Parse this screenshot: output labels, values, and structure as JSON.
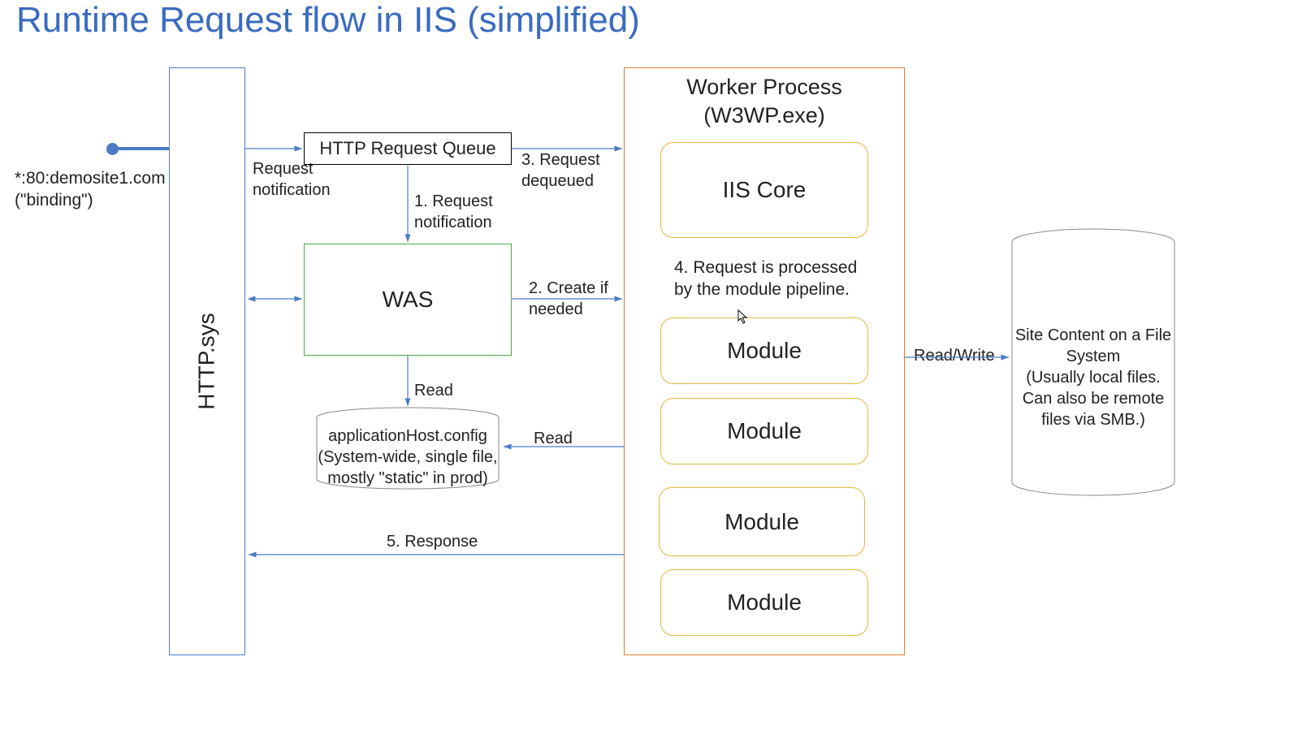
{
  "title": "Runtime Request flow in IIS (simplified)",
  "binding_line1": "*:80:demosite1.com",
  "binding_line2": "(\"binding\")",
  "httpsys": "HTTP.sys",
  "queue": "HTTP Request Queue",
  "was": "WAS",
  "worker_title_line1": "Worker Process",
  "worker_title_line2": "(W3WP.exe)",
  "iis_core": "IIS Core",
  "module": "Module",
  "pipeline_note": "4. Request is processed by the module pipeline.",
  "labels": {
    "req_notif_left": "Request notification",
    "step1": "1. Request notification",
    "step2": "2. Create if needed",
    "step3": "3. Request dequeued",
    "read_was": "Read",
    "read_worker": "Read",
    "step5": "5. Response",
    "readwrite": "Read/Write"
  },
  "apphost_line1": "applicationHost.config",
  "apphost_line2": "(System-wide, single file,",
  "apphost_line3": "mostly \"static\" in prod)",
  "fs_line1": "Site Content on a File",
  "fs_line2": "System",
  "fs_line3": "(Usually local files.",
  "fs_line4": "Can also be remote",
  "fs_line5": "files via SMB.)"
}
